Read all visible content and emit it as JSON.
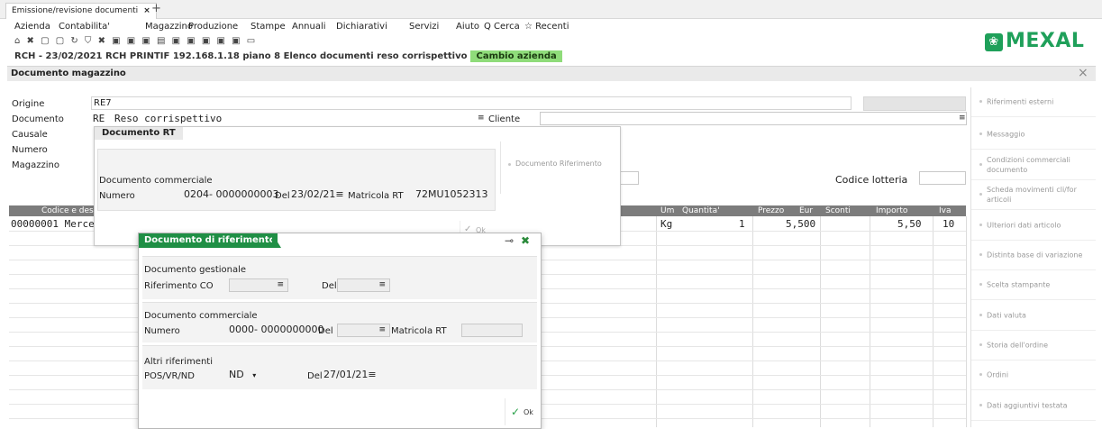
{
  "tab": {
    "title": "Emissione/revisione documenti",
    "close": "×",
    "new": "+"
  },
  "menu": [
    "Azienda",
    "Contabilita'",
    "Magazzino",
    "Produzione",
    "Stampe",
    "Annuali",
    "Dichiarativi",
    "Servizi",
    "Aiuto",
    "Q Cerca",
    "☆ Recenti"
  ],
  "toolbar_glyphs": "⌂ ✖ ▢ ▢  ↻ ⛉  ✖  ▣ ▣ ▣ ▤  ▣ ▣ ▣ ▣ ▣  ▭",
  "logo": {
    "mark": "❀",
    "text": "MEXAL"
  },
  "status": {
    "text": "RCH - 23/02/2021  RCH PRINTIF 192.168.1.18 piano 8  Elenco documenti reso corrispettivo",
    "button": "Cambio azienda"
  },
  "window": {
    "title": "Documento magazzino",
    "close": "×"
  },
  "form": {
    "origine_label": "Origine",
    "origine_value": "RE7",
    "documento_label": "Documento",
    "documento_code": "RE",
    "documento_desc": "Reso corrispettivo",
    "documento_menu": "≡",
    "cliente_label": "Cliente",
    "cliente_menu": "≡",
    "causale_label": "Causale",
    "numero_label": "Numero",
    "magazzino_label": "Magazzino",
    "codice_lotteria_label": "Codice lotteria"
  },
  "grid": {
    "headers": {
      "codice": "Codice e des",
      "um": "Um",
      "quantita": "Quantita'",
      "prezzo": "Prezzo",
      "eur": "Eur",
      "sconti": "Sconti",
      "importo": "Importo",
      "iva": "Iva"
    },
    "row": {
      "codice": "00000001 Merce",
      "um": "Kg",
      "quantita": "1",
      "prezzo": "5,500",
      "importo": "5,50",
      "iva": "10"
    }
  },
  "sidebar": [
    "Riferimenti esterni",
    "Messaggio",
    "Condizioni commerciali documento",
    "Scheda movimenti cli/for articoli",
    "Ulteriori dati articolo",
    "Distinta base di variazione",
    "Scelta stampante",
    "Dati valuta",
    "Storia dell'ordine",
    "Ordini",
    "Dati aggiuntivi testata"
  ],
  "dlg_rt": {
    "title": "Documento RT",
    "section": "Documento commerciale",
    "numero_label": "Numero",
    "numero_value": "0204- 0000000003",
    "del_label": "Del",
    "del_value": "23/02/21≡",
    "matricola_label": "Matricola RT",
    "matricola_value": "72MU1052313",
    "side_button": "Documento Riferimento",
    "ok_label": "Ok"
  },
  "dlg_ref": {
    "title": "Documento di riferimento",
    "pin": "⊸",
    "close": "✖",
    "gest_section": "Documento gestionale",
    "rif_co_label": "Riferimento CO",
    "rif_co_menu": "≡",
    "del1_label": "Del",
    "del1_menu": "≡",
    "comm_section": "Documento commerciale",
    "numero_label": "Numero",
    "numero_value": "0000- 0000000000",
    "del2_label": "Del",
    "del2_menu": "≡",
    "matricola_label": "Matricola RT",
    "altri_section": "Altri riferimenti",
    "pos_label": "POS/VR/ND",
    "pos_value": "ND",
    "del3_label": "Del",
    "del3_value": "27/01/21≡",
    "ok_label": "Ok"
  }
}
